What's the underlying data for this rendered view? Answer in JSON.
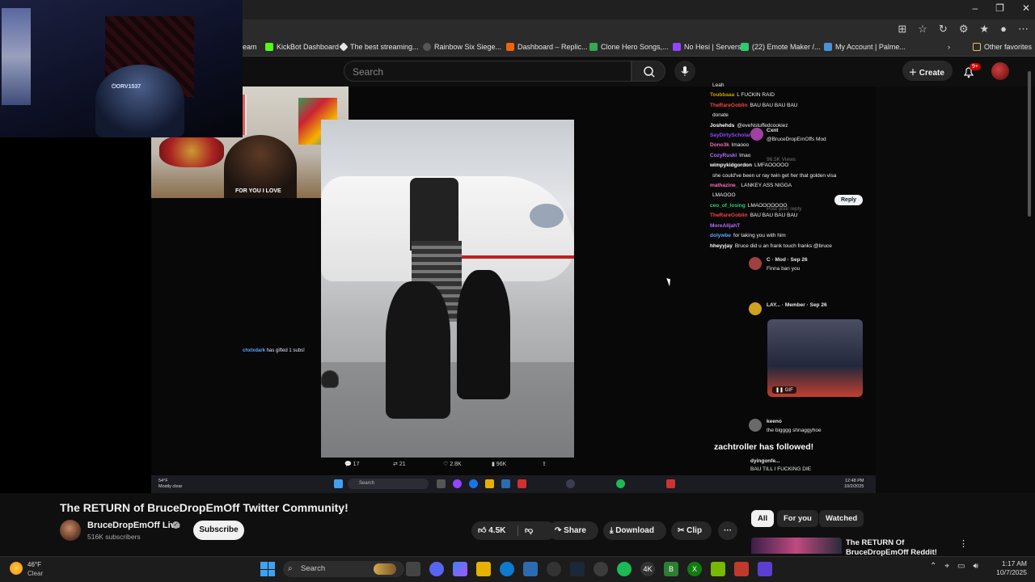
{
  "browser": {
    "bookmarks": [
      {
        "label": "eam",
        "color": "#888888"
      },
      {
        "label": "KickBot Dashboard",
        "color": "#53fc18"
      },
      {
        "label": "The best streaming...",
        "color": "#e6e6e6"
      },
      {
        "label": "Rainbow Six Siege...",
        "color": "#e6e6e6"
      },
      {
        "label": "Dashboard – Replic...",
        "color": "#f26207"
      },
      {
        "label": "Clone Hero Songs,...",
        "color": "#34a853"
      },
      {
        "label": "No Hesi | Servers",
        "color": "#9146ff"
      },
      {
        "label": "(22) Emote Maker /...",
        "color": "#2ecc71"
      },
      {
        "label": "My Account | Palme...",
        "color": "#4a90d9"
      },
      {
        "label": "Other favorites",
        "color": "#e6c25a"
      }
    ],
    "window_controls": [
      "–",
      "❐",
      "✕"
    ]
  },
  "youtube_header": {
    "search_placeholder": "Search",
    "create_label": "Create",
    "notification_badge": "9+"
  },
  "webcam": {
    "tag": "⏻ORV1537"
  },
  "stream": {
    "cam_shirt_text": "FOR YOU I LOVE",
    "gift_user": "chxlxdark",
    "gift_text": "has gifted 1 subs!",
    "tweet_actions": {
      "replies": "17",
      "retweets": "21",
      "likes": "2.8K",
      "views": "96K"
    },
    "chat": [
      {
        "user": "",
        "text": "Leah",
        "color": "#9acd32"
      },
      {
        "user": "Toubbaaa",
        "text": "L FUCKIN RAID",
        "color": "#c8a200"
      },
      {
        "user": "TheRareGoblin",
        "text": "BAU BAU BAU BAU",
        "color": "#ff4040"
      },
      {
        "user": "",
        "text": "donate",
        "color": "#9acd32"
      },
      {
        "user": "Joshehds",
        "text": "@eveNstuffedcookiez",
        "color": "#ffffff"
      },
      {
        "user": "SayDirtyScholar",
        "text": "",
        "color": "#9146ff"
      },
      {
        "user": "Dono3k",
        "text": "lmaooo",
        "color": "#ff69b4"
      },
      {
        "user": "CozyRuski",
        "text": "lmao",
        "color": "#b56cff"
      },
      {
        "user": "wimpykidgordon",
        "text": "LMFAOOOOO",
        "color": "#ffffff"
      },
      {
        "user": "",
        "text": "she could've been ur ray twin get her that golden visa",
        "color": "#ffffff"
      },
      {
        "user": "mathazine_",
        "text": "LANKEY ASS NIGGA",
        "color": "#ff69b4"
      },
      {
        "user": "",
        "text": "LMAOOO",
        "color": "#ffffff"
      },
      {
        "user": "ceo_of_losing",
        "text": "LMAOOOOOOO",
        "color": "#2ecc71"
      },
      {
        "user": "TheRareGoblin",
        "text": "BAU BAU BAU BAU",
        "color": "#ff4040"
      },
      {
        "user": "MoreAlljahT",
        "text": "",
        "color": "#b56cff"
      },
      {
        "user": "dolywbe",
        "text": "for taking you with him",
        "color": "#59a6ff"
      },
      {
        "user": "hheyyjay",
        "text": "Bruce did u an frank touch franks @bruce",
        "color": "#ffffff"
      }
    ],
    "thread": {
      "reply_placeholder": "Post your reply",
      "reply_button": "Reply",
      "tweets": [
        {
          "name": "Cxnt",
          "text": "@BruceDropEmOffs",
          "badge": "Mod",
          "date": "",
          "stats": "96.5K Views",
          "color": "#a040a0"
        },
        {
          "name": "C",
          "text": "Finna ban you",
          "badge": "Mod",
          "date": "Sep 26",
          "stats": "",
          "color": "#a04040"
        },
        {
          "name": "LAY...",
          "text": "",
          "badge": "Member",
          "date": "Sep 26",
          "stats": "",
          "color": "#d0a020"
        },
        {
          "name": "keeno",
          "text": "the bigggg shnaggyhoe",
          "badge": "",
          "date": "",
          "stats": "",
          "color": "#6a6a6a"
        }
      ],
      "gif_label": "GIF",
      "last_user": "dyingonfe...",
      "last_text": "BAU TILL I FUCKING DIE"
    },
    "followed_alert": "zachtroller has followed!",
    "inner_taskbar": {
      "weather_temp": "54°F",
      "weather_desc": "Mostly clear",
      "search_label": "Search",
      "time": "12:48 PM",
      "date": "10/2/2025"
    }
  },
  "video": {
    "title": "The RETURN of BruceDropEmOff Twitter Community!",
    "channel": "BruceDropEmOff Live",
    "subscribers": "516K subscribers",
    "subscribe_label": "Subscribe",
    "likes": "4.5K",
    "share_label": "Share",
    "download_label": "Download",
    "clip_label": "Clip",
    "more_label": "···"
  },
  "sidebar": {
    "chips": [
      "All",
      "For you",
      "Watched"
    ],
    "recommendation_title": "The RETURN Of BruceDropEmOff Reddit!"
  },
  "taskbar": {
    "weather_temp": "46°F",
    "weather_desc": "Clear",
    "search_label": "Search",
    "time": "1:17 AM",
    "date": "10/7/2025"
  }
}
